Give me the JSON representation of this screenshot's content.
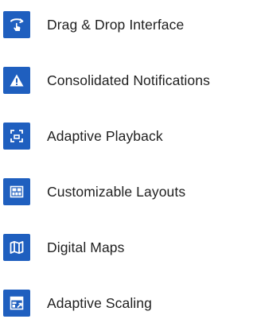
{
  "theme": {
    "icon_bg": "#1f5fbf",
    "icon_fg": "#ffffff",
    "text": "#1f1f1f"
  },
  "features": [
    {
      "label": "Drag & Drop Interface",
      "icon": "touch-gesture-icon"
    },
    {
      "label": "Consolidated Notifications",
      "icon": "warning-icon"
    },
    {
      "label": "Adaptive Playback",
      "icon": "fit-screen-icon"
    },
    {
      "label": "Customizable Layouts",
      "icon": "layout-grid-icon"
    },
    {
      "label": "Digital Maps",
      "icon": "map-icon"
    },
    {
      "label": "Adaptive Scaling",
      "icon": "scaling-icon"
    }
  ]
}
